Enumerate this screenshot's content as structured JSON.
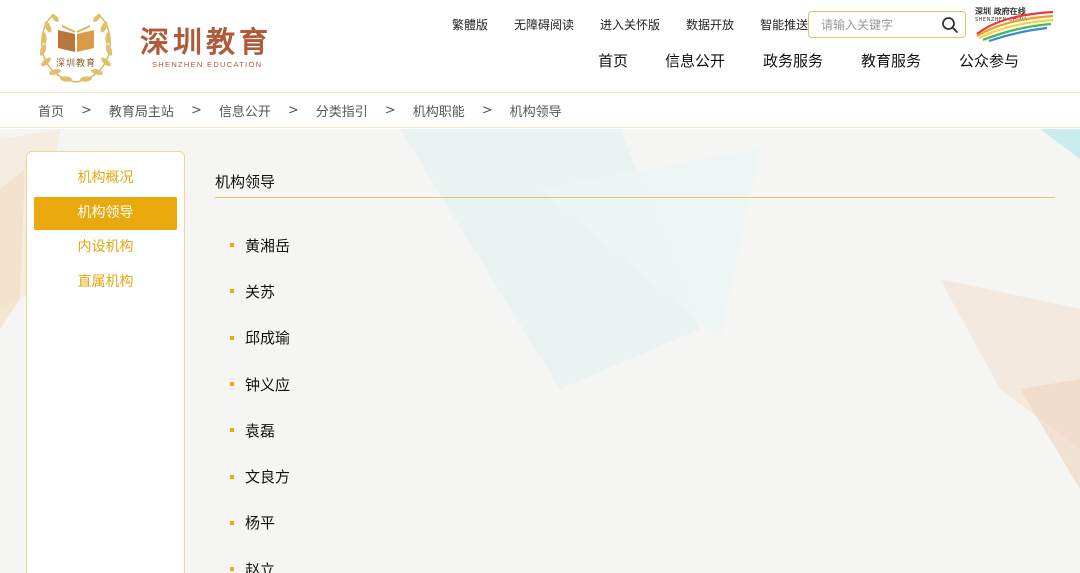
{
  "header": {
    "logo_seal_text": "深圳教育",
    "logo_cn": "深圳教育",
    "logo_en": "SHENZHEN EDUCATION",
    "util_links": [
      "繁體版",
      "无障碍阅读",
      "进入关怀版",
      "数据开放",
      "智能推送"
    ],
    "search": {
      "placeholder": "请输入关键字",
      "value": ""
    },
    "sz_logo": {
      "cn": "深圳 政府在线",
      "en": "SHENZHEN CHINA"
    },
    "nav": [
      "首页",
      "信息公开",
      "政务服务",
      "教育服务",
      "公众参与"
    ]
  },
  "breadcrumb": [
    "首页",
    "教育局主站",
    "信息公开",
    "分类指引",
    "机构职能",
    "机构领导"
  ],
  "breadcrumb_sep": ">",
  "sidebar": {
    "items": [
      {
        "label": "机构概况",
        "active": false
      },
      {
        "label": "机构领导",
        "active": true
      },
      {
        "label": "内设机构",
        "active": false
      },
      {
        "label": "直属机构",
        "active": false
      }
    ]
  },
  "main": {
    "title": "机构领导",
    "leaders": [
      "黄湘岳",
      "关苏",
      "邱成瑜",
      "钟义应",
      "袁磊",
      "文良方",
      "杨平",
      "赵立"
    ]
  },
  "colors": {
    "accent": "#e9a80b",
    "brand": "#b05a3a",
    "border": "#ecd79b"
  }
}
